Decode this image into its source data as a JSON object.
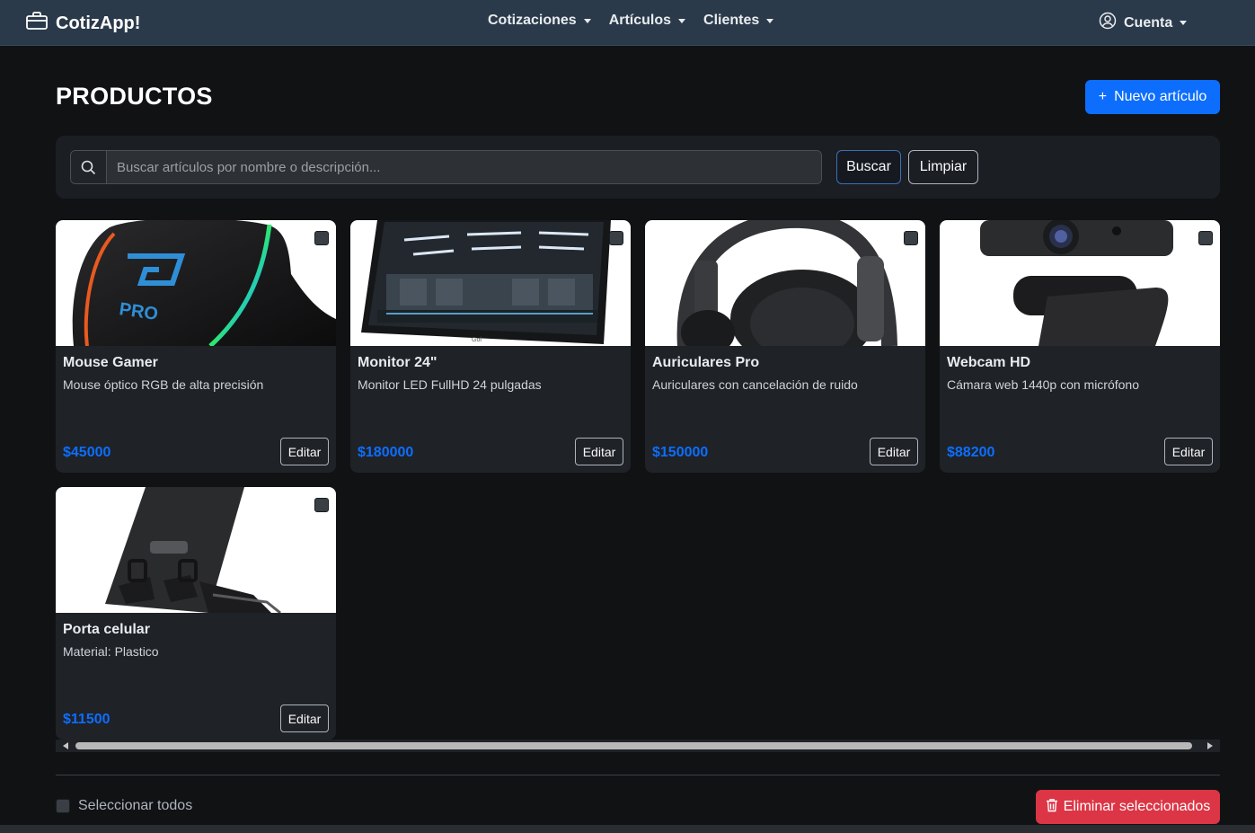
{
  "navbar": {
    "brand": "CotizApp!",
    "menus": [
      {
        "label": "Cotizaciones"
      },
      {
        "label": "Artículos"
      },
      {
        "label": "Clientes"
      }
    ],
    "account_label": "Cuenta"
  },
  "page": {
    "title": "PRODUCTOS",
    "new_button": "Nuevo artículo"
  },
  "search": {
    "placeholder": "Buscar artículos por nombre o descripción...",
    "value": "",
    "search_button": "Buscar",
    "clear_button": "Limpiar"
  },
  "products": [
    {
      "name": "Mouse Gamer",
      "description": "Mouse óptico RGB de alta precisión",
      "price": "$45000",
      "edit_label": "Editar",
      "selected": false
    },
    {
      "name": "Monitor 24\"",
      "description": "Monitor LED FullHD 24 pulgadas",
      "price": "$180000",
      "edit_label": "Editar",
      "selected": false
    },
    {
      "name": "Auriculares Pro",
      "description": "Auriculares con cancelación de ruido",
      "price": "$150000",
      "edit_label": "Editar",
      "selected": false
    },
    {
      "name": "Webcam HD",
      "description": "Cámara web 1440p con micrófono",
      "price": "$88200",
      "edit_label": "Editar",
      "selected": false
    },
    {
      "name": "Porta celular",
      "description": "Material: Plastico",
      "price": "$11500",
      "edit_label": "Editar",
      "selected": false
    }
  ],
  "footer": {
    "select_all_label": "Seleccionar todos",
    "delete_button": "Eliminar seleccionados"
  },
  "colors": {
    "primary": "#0d6efd",
    "danger": "#dc3545",
    "navbar": "#2b3a4a",
    "background": "#111214"
  }
}
